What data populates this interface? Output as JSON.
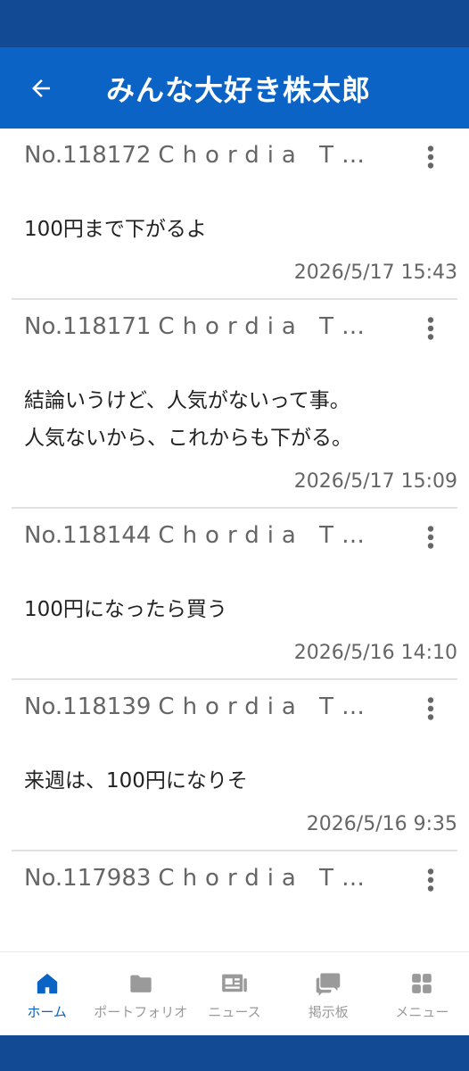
{
  "app_bar": {
    "title": "みんな大好き株太郎",
    "back_icon": "arrow-left-icon"
  },
  "posts": [
    {
      "number": "No.118172",
      "author": "Chordia T…",
      "lines": [
        "100円まで下がるよ"
      ],
      "time": "2026/5/17 15:43"
    },
    {
      "number": "No.118171",
      "author": "Chordia T…",
      "lines": [
        "結論いうけど、人気がないって事。",
        "人気ないから、これからも下がる。"
      ],
      "time": "2026/5/17 15:09"
    },
    {
      "number": "No.118144",
      "author": "Chordia T…",
      "lines": [
        "100円になったら買う"
      ],
      "time": "2026/5/16 14:10"
    },
    {
      "number": "No.118139",
      "author": "Chordia T…",
      "lines": [
        "来週は、100円になりそ"
      ],
      "time": "2026/5/16 9:35"
    },
    {
      "number": "No.117983",
      "author": "Chordia T…",
      "lines": [],
      "time": ""
    }
  ],
  "bottom_nav": {
    "items": [
      {
        "label": "ホーム",
        "icon": "home-icon",
        "active": true
      },
      {
        "label": "ポートフォリオ",
        "icon": "folder-icon",
        "active": false
      },
      {
        "label": "ニュース",
        "icon": "newspaper-icon",
        "active": false
      },
      {
        "label": "掲示板",
        "icon": "chat-bubbles-icon",
        "active": false
      },
      {
        "label": "メニュー",
        "icon": "grid-icon",
        "active": false
      }
    ]
  },
  "colors": {
    "primary": "#0b63c6",
    "status_bar": "#124a93",
    "inactive": "#9a9a9a"
  }
}
